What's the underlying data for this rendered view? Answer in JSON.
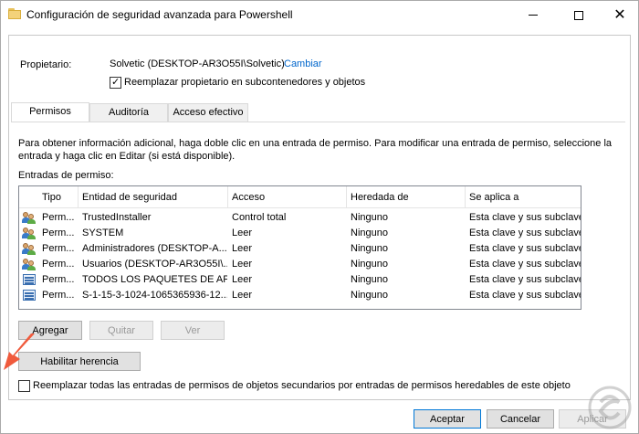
{
  "window": {
    "title": "Configuración de seguridad avanzada para Powershell",
    "controls": {
      "minimize": "minimize-icon",
      "maximize": "maximize-icon",
      "close": "✕"
    }
  },
  "owner": {
    "label": "Propietario:",
    "value": "Solvetic (DESKTOP-AR3O55I\\Solvetic)",
    "change_link": "Cambiar",
    "replace_checkbox_label": "Reemplazar propietario en subcontenedores y objetos",
    "replace_checked": true
  },
  "tabs": [
    {
      "label": "Permisos",
      "active": true
    },
    {
      "label": "Auditoría",
      "active": false
    },
    {
      "label": "Acceso efectivo",
      "active": false
    }
  ],
  "info_text": "Para obtener información adicional, haga doble clic en una entrada de permiso. Para modificar una entrada de permiso, seleccione la entrada y haga clic en Editar (si está disponible).",
  "entries_label": "Entradas de permiso:",
  "table": {
    "columns": [
      "Tipo",
      "Entidad de seguridad",
      "Acceso",
      "Heredada de",
      "Se aplica a"
    ],
    "rows": [
      {
        "icon": "users-icon",
        "tipo": "Perm...",
        "entidad": "TrustedInstaller",
        "acceso": "Control total",
        "heredada": "Ninguno",
        "aplica": "Esta clave y sus subclaves"
      },
      {
        "icon": "users-icon",
        "tipo": "Perm...",
        "entidad": "SYSTEM",
        "acceso": "Leer",
        "heredada": "Ninguno",
        "aplica": "Esta clave y sus subclaves"
      },
      {
        "icon": "users-icon",
        "tipo": "Perm...",
        "entidad": "Administradores (DESKTOP-A...",
        "acceso": "Leer",
        "heredada": "Ninguno",
        "aplica": "Esta clave y sus subclaves"
      },
      {
        "icon": "users-icon",
        "tipo": "Perm...",
        "entidad": "Usuarios (DESKTOP-AR3O55I\\...",
        "acceso": "Leer",
        "heredada": "Ninguno",
        "aplica": "Esta clave y sus subclaves"
      },
      {
        "icon": "package-icon",
        "tipo": "Perm...",
        "entidad": "TODOS LOS PAQUETES DE AP...",
        "acceso": "Leer",
        "heredada": "Ninguno",
        "aplica": "Esta clave y sus subclaves"
      },
      {
        "icon": "package-icon",
        "tipo": "Perm...",
        "entidad": "S-1-15-3-1024-1065365936-12...",
        "acceso": "Leer",
        "heredada": "Ninguno",
        "aplica": "Esta clave y sus subclaves"
      }
    ]
  },
  "buttons": {
    "add": "Agregar",
    "remove": "Quitar",
    "view": "Ver",
    "enable_inheritance": "Habilitar herencia",
    "ok": "Aceptar",
    "cancel": "Cancelar",
    "apply": "Aplicar"
  },
  "replace_children": {
    "label": "Reemplazar todas las entradas de permisos de objetos secundarios por entradas de permisos heredables de este objeto",
    "checked": false
  },
  "colors": {
    "link": "#0066cc",
    "accent": "#0078d7",
    "arrow": "#f05a3c"
  }
}
